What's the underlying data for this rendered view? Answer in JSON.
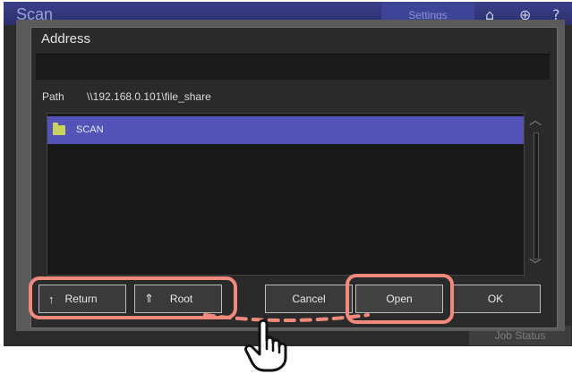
{
  "app": {
    "title": "Scan",
    "settings_tab": "Settings",
    "job_status": "Job Status"
  },
  "dialog": {
    "title": "Address",
    "address_value": "",
    "path_label": "Path",
    "path_value": "\\\\192.168.0.101\\file_share"
  },
  "file_list": {
    "items": [
      {
        "name": "SCAN",
        "icon": "folder-icon",
        "selected": true
      }
    ]
  },
  "buttons": {
    "return_label": "Return",
    "root_label": "Root",
    "cancel_label": "Cancel",
    "open_label": "Open",
    "ok_label": "OK"
  },
  "icons": {
    "home": "home-icon",
    "globe": "globe-icon",
    "help": "help-icon",
    "return": "return-arrow-icon",
    "root": "root-double-arrow-icon",
    "pointer": "hand-pointer-icon"
  },
  "colors": {
    "selection": "#5353b8",
    "folder": "#c9d35c",
    "highlight": "#f08a7d",
    "topbar": "#3a3f8a"
  }
}
